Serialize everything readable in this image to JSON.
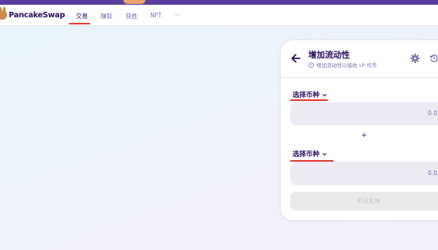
{
  "app": {
    "brand": "PancakeSwap"
  },
  "nav": {
    "items": [
      {
        "label": "交易",
        "active": true
      },
      {
        "label": "赚取",
        "active": false
      },
      {
        "label": "获胜",
        "active": false
      },
      {
        "label": "NFT",
        "active": false
      },
      {
        "label": "···",
        "active": false
      }
    ]
  },
  "liquidity_card": {
    "title": "增加流动性",
    "subtitle": "增加流动性以接收 LP 代币",
    "token_a": {
      "select_label": "选择币种",
      "amount": "0.0"
    },
    "plus": "+",
    "token_b": {
      "select_label": "选择币种",
      "amount": "0.0"
    },
    "submit_label": "币对无效"
  },
  "colors": {
    "accent_purple": "#280d5f",
    "muted_text": "#7a6eaa",
    "annotation_red": "#e8382e",
    "input_bg": "#eeeaf4",
    "disabled_button": "#e9eaeb"
  }
}
